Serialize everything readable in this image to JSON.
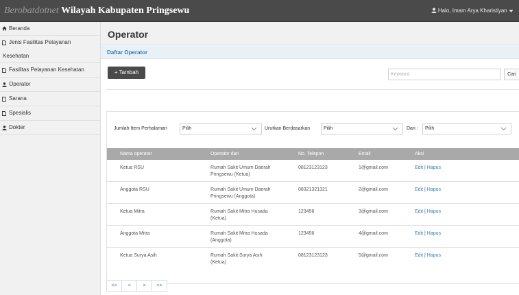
{
  "header": {
    "brand_italic": "Berobatdotnet",
    "brand_bold": "Wilayah Kabupaten Pringsewu",
    "user_greeting": "Halo, Imam Arya Kharistiyan"
  },
  "sidebar": {
    "items": [
      {
        "icon": "home-icon",
        "label": "Beranda"
      },
      {
        "icon": "document-icon",
        "label": "Jenis Fasilitas Pelayanan",
        "label2": "Kesehatan"
      },
      {
        "icon": "document-icon",
        "label": "Fasilitas Pelayanan Kesehatan"
      },
      {
        "icon": "user-icon",
        "label": "Operator"
      },
      {
        "icon": "document-icon",
        "label": "Sarana"
      },
      {
        "icon": "document-icon",
        "label": "Spesialis"
      },
      {
        "icon": "user-icon",
        "label": "Dokter"
      }
    ]
  },
  "main": {
    "title": "Operator",
    "subheader": "Daftar Operator",
    "add_label": "+ Tambah",
    "search_placeholder": "Keyword",
    "search_button": "Cari"
  },
  "filters": {
    "items_per_page_label": "Jumlah Item Perhalaman",
    "items_per_page_value": "Pilih",
    "sort_by_label": "Urutkan Berdasarkan",
    "sort_by_value": "Pilih",
    "order_label": "Dari :",
    "order_value": "Pilih"
  },
  "table": {
    "columns": [
      "Nama operator",
      "Operator dari",
      "No. Telepon",
      "Email",
      "Aksi"
    ],
    "rows": [
      {
        "name": "Ketua RSU",
        "from1": "Rumah Sakit Umum Daerah",
        "from2": "Pringsewu (Ketua)",
        "phone": "08123123123",
        "email": "1@gmail.com"
      },
      {
        "name": "Anggota RSU",
        "from1": "Rumah Sakit Umum Daerah",
        "from2": "Pringsewu (Anggota)",
        "phone": "08321321321",
        "email": "2@gmail.com"
      },
      {
        "name": "Ketua Mitra",
        "from1": "Rumah Sakit Mitra Husada",
        "from2": "(Ketua)",
        "phone": "123456",
        "email": "3@gmail.com"
      },
      {
        "name": "Anggota Mitra",
        "from1": "Rumah Sakit Mitra Husada",
        "from2": "(Anggota)",
        "phone": "123456",
        "email": "4@gmail.com"
      },
      {
        "name": "Ketua Surya Asih",
        "from1": "Rumah Sakit Surya Asih",
        "from2": "(Ketua)",
        "phone": "08123123123",
        "email": "5@gmail.com"
      }
    ],
    "edit_label": "Edit",
    "action_separator": "|",
    "delete_label": "Hapus"
  },
  "pagination": [
    "<<",
    "<",
    ">",
    ">>"
  ],
  "colors": {
    "topbar": "#4a4a4a",
    "sidebar": "#f1f1f1",
    "link": "#2f7db6",
    "table_header": "#a9a9a9"
  }
}
